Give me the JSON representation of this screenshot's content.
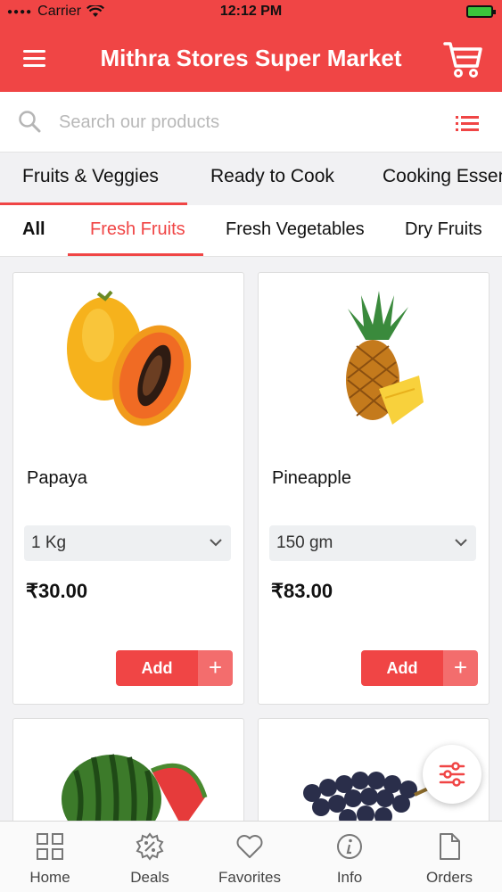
{
  "status_bar": {
    "carrier": "Carrier",
    "time": "12:12 PM"
  },
  "header": {
    "title": "Mithra Stores Super Market"
  },
  "search": {
    "placeholder": "Search our products"
  },
  "category_tabs": [
    "Fruits & Veggies",
    "Ready to Cook",
    "Cooking Essen"
  ],
  "sub_tabs": [
    "All",
    "Fresh Fruits",
    "Fresh Vegetables",
    "Dry Fruits"
  ],
  "products": [
    {
      "name": "Papaya",
      "unit": "1 Kg",
      "price": "₹30.00",
      "add_label": "Add",
      "plus": "+"
    },
    {
      "name": "Pineapple",
      "unit": "150 gm",
      "price": "₹83.00",
      "add_label": "Add",
      "plus": "+"
    }
  ],
  "bottom_nav": [
    {
      "label": "Home",
      "icon": "grid-icon"
    },
    {
      "label": "Deals",
      "icon": "badge-percent-icon"
    },
    {
      "label": "Favorites",
      "icon": "heart-icon"
    },
    {
      "label": "Info",
      "icon": "info-icon"
    },
    {
      "label": "Orders",
      "icon": "document-icon"
    }
  ],
  "colors": {
    "accent": "#f04545",
    "accent_light": "#f36d6d"
  }
}
